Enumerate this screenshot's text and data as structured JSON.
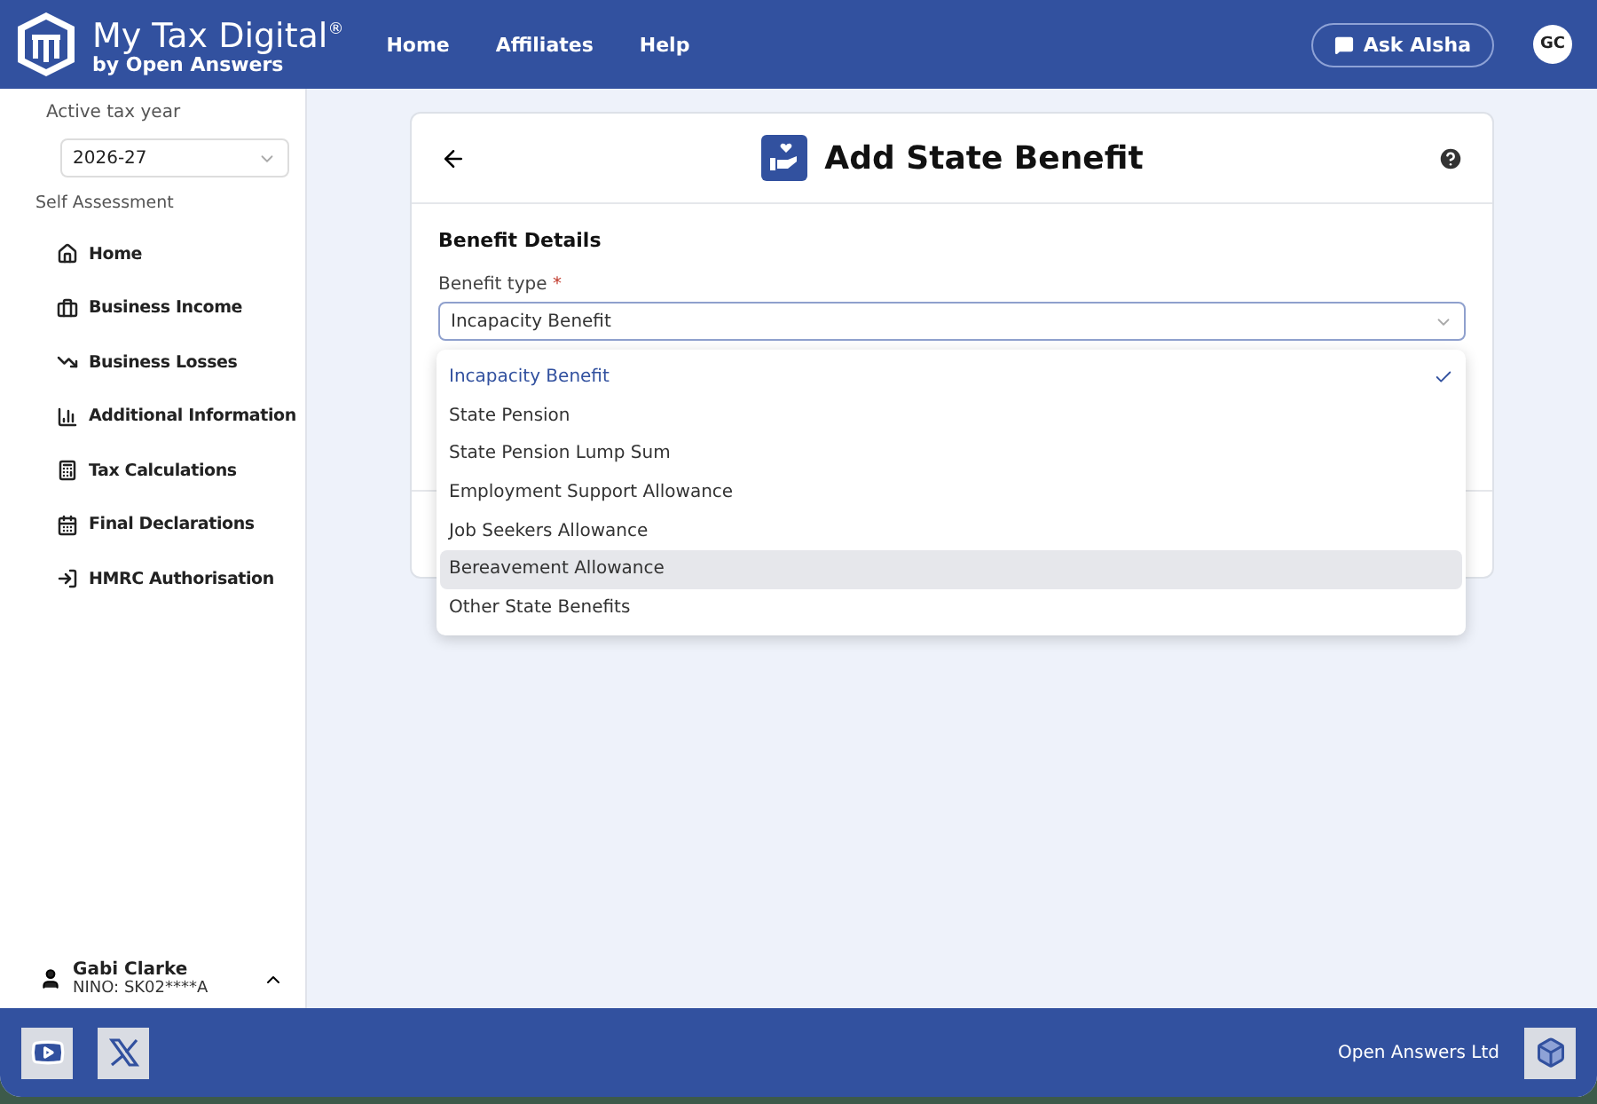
{
  "header": {
    "brand": "My Tax Digital",
    "brand_mark": "®",
    "tagline": "by Open Answers",
    "nav": [
      {
        "label": "Home"
      },
      {
        "label": "Affiliates"
      },
      {
        "label": "Help"
      }
    ],
    "assistant_button": "Ask AIsha",
    "avatar": "GC"
  },
  "sidebar": {
    "tax_year_label": "Active tax year",
    "tax_year": "2026-27",
    "section": "Self Assessment",
    "items": [
      {
        "label": "Home"
      },
      {
        "label": "Business Income"
      },
      {
        "label": "Business Losses"
      },
      {
        "label": "Additional Information"
      },
      {
        "label": "Tax Calculations"
      },
      {
        "label": "Final Declarations"
      },
      {
        "label": "HMRC Authorisation"
      }
    ],
    "user": {
      "name": "Gabi Clarke",
      "nino": "NINO: SK02****A",
      "expanded": false
    }
  },
  "card": {
    "title": "Add State Benefit",
    "section": "Benefit Details",
    "field_label": "Benefit type",
    "required": "*",
    "value": "Incapacity Benefit",
    "options": [
      {
        "label": "Incapacity Benefit",
        "selected": true,
        "hovered": false
      },
      {
        "label": "State Pension",
        "selected": false,
        "hovered": false
      },
      {
        "label": "State Pension Lump Sum",
        "selected": false,
        "hovered": false
      },
      {
        "label": "Employment Support Allowance",
        "selected": false,
        "hovered": false
      },
      {
        "label": "Job Seekers Allowance",
        "selected": false,
        "hovered": false
      },
      {
        "label": "Bereavement Allowance",
        "selected": false,
        "hovered": true
      },
      {
        "label": "Other State Benefits",
        "selected": false,
        "hovered": false
      }
    ]
  },
  "footer": {
    "company": "Open Answers Ltd"
  }
}
